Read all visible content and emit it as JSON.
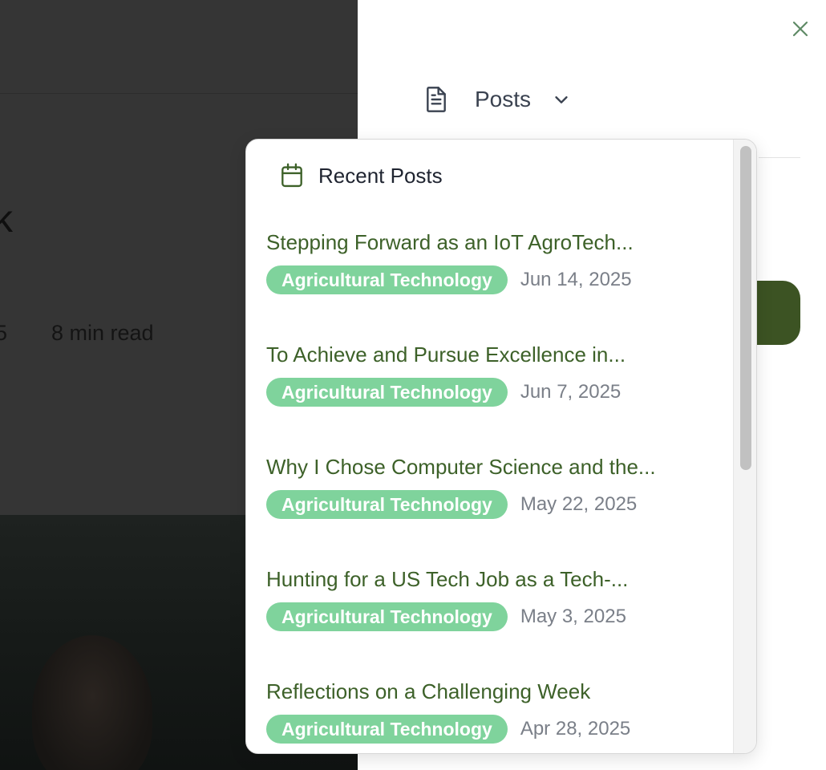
{
  "background": {
    "date_fragment": "5",
    "read_time": "8 min read",
    "title_fragment": "k"
  },
  "drawer": {
    "nav_label": "Posts",
    "close_icon": "close-icon",
    "doc_icon": "document-icon",
    "chevron_icon": "chevron-down-icon"
  },
  "dropdown": {
    "header": "Recent Posts",
    "header_icon": "calendar-icon",
    "posts": [
      {
        "title": "Stepping Forward as an IoT AgroTech...",
        "tag": "Agricultural Technology",
        "date": "Jun 14, 2025"
      },
      {
        "title": "To Achieve and Pursue Excellence in...",
        "tag": "Agricultural Technology",
        "date": "Jun 7, 2025"
      },
      {
        "title": "Why I Chose Computer Science and the...",
        "tag": "Agricultural Technology",
        "date": "May 22, 2025"
      },
      {
        "title": "Hunting for a US Tech Job as a Tech-...",
        "tag": "Agricultural Technology",
        "date": "May 3, 2025"
      },
      {
        "title": "Reflections on a Challenging Week",
        "tag": "Agricultural Technology",
        "date": "Apr 28, 2025"
      }
    ]
  },
  "colors": {
    "accent_green": "#3d6129",
    "tag_green": "#7fd39c",
    "button_dark_green": "#3c5323"
  }
}
